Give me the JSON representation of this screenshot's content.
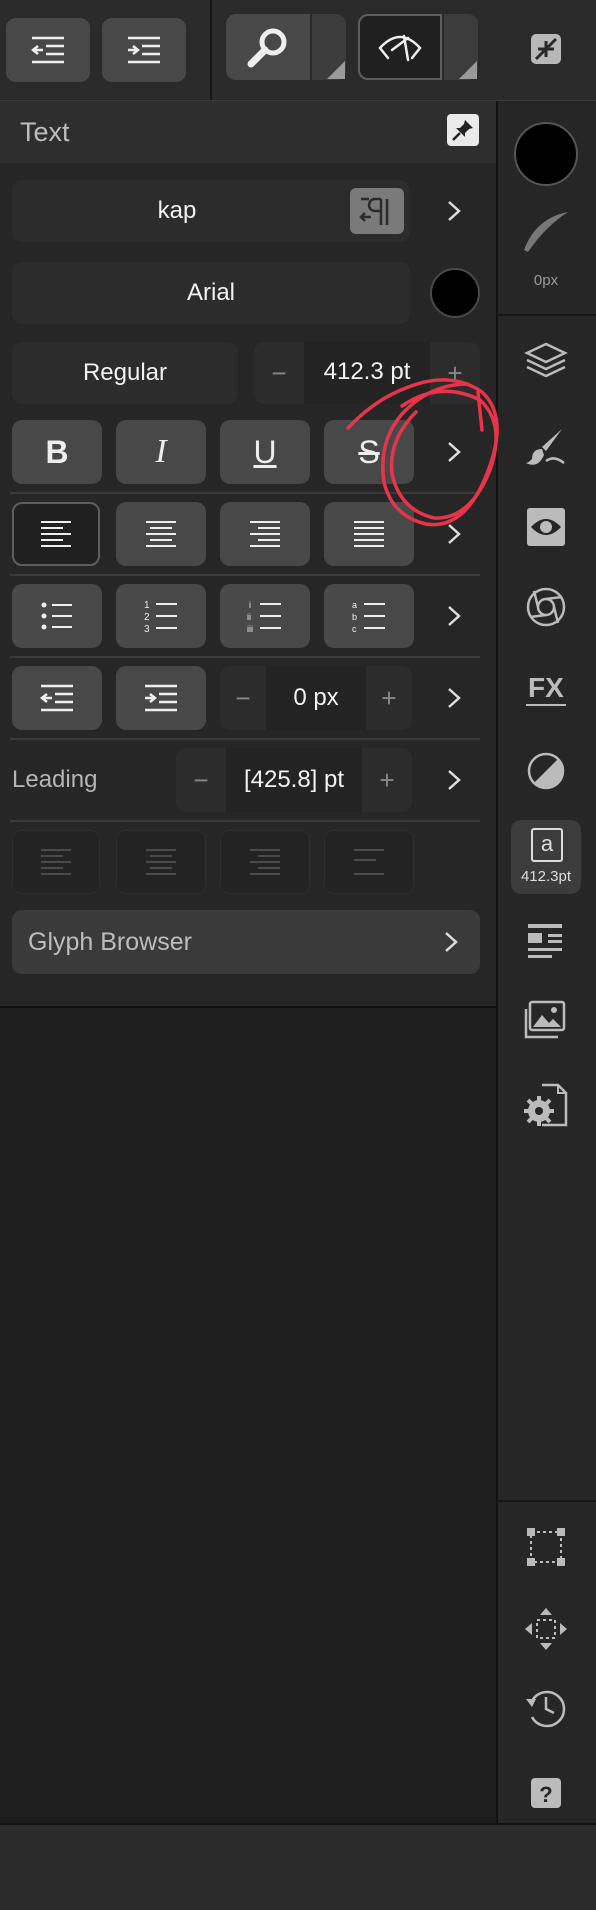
{
  "toolbar": {
    "outdent_icon": "outdent-icon",
    "indent_icon": "indent-icon",
    "search_icon": "search-icon",
    "view_icon": "view-mode-icon",
    "collapse_icon": "collapse-icon"
  },
  "panel": {
    "title": "Text",
    "pin_icon": "pin-icon",
    "style_name": "kap",
    "paragraph_icon": "paragraph-direction-icon",
    "font_family": "Arial",
    "font_color": "#000000",
    "font_weight": "Regular",
    "font_size": "412.3 pt",
    "minus": "−",
    "plus": "+",
    "bold": "B",
    "italic": "I",
    "underline": "U",
    "strike": "S",
    "indent_value": "0 px",
    "leading_label": "Leading",
    "leading_value": "[425.8] pt",
    "glyph_browser": "Glyph Browser"
  },
  "right_bar": {
    "brush_size": "0px",
    "color_swatch": "#000000",
    "text_tool_letter": "a",
    "text_tool_size": "412.3pt",
    "icons": [
      "layers-icon",
      "brush-icon",
      "eye-mask-icon",
      "adjustments-icon",
      "fx-icon",
      "tone-icon",
      "text-icon",
      "paragraph-styles-icon",
      "gallery-icon",
      "document-settings-icon",
      "selection-transform-icon",
      "move-icon",
      "history-icon",
      "help-icon"
    ]
  },
  "annotation": {
    "color": "#e8344a"
  }
}
